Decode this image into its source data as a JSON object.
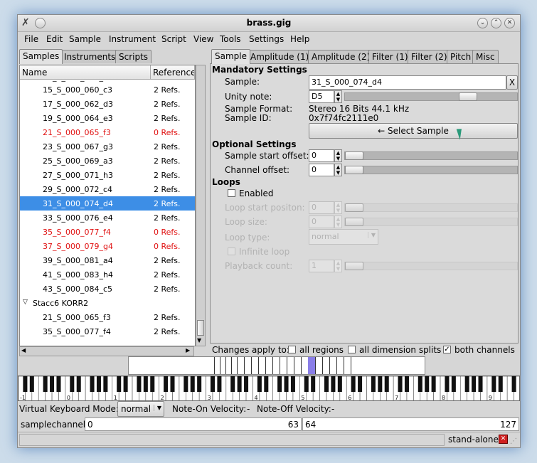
{
  "window": {
    "title": "brass.gig"
  },
  "menu": [
    "File",
    "Edit",
    "Sample",
    "Instrument",
    "Script",
    "View",
    "Tools",
    "Settings",
    "Help"
  ],
  "left_tabs": [
    "Samples",
    "Instruments",
    "Scripts"
  ],
  "list": {
    "columns": [
      "Name",
      "Reference"
    ],
    "rows": [
      {
        "name": "15_S_000_060_c3",
        "refs": "2 Refs.",
        "state": "normal"
      },
      {
        "name": "17_S_000_062_d3",
        "refs": "2 Refs.",
        "state": "normal"
      },
      {
        "name": "19_S_000_064_e3",
        "refs": "2 Refs.",
        "state": "normal"
      },
      {
        "name": "21_S_000_065_f3",
        "refs": "0 Refs.",
        "state": "unused"
      },
      {
        "name": "23_S_000_067_g3",
        "refs": "2 Refs.",
        "state": "normal"
      },
      {
        "name": "25_S_000_069_a3",
        "refs": "2 Refs.",
        "state": "normal"
      },
      {
        "name": "27_S_000_071_h3",
        "refs": "2 Refs.",
        "state": "normal"
      },
      {
        "name": "29_S_000_072_c4",
        "refs": "2 Refs.",
        "state": "normal"
      },
      {
        "name": "31_S_000_074_d4",
        "refs": "2 Refs.",
        "state": "selected"
      },
      {
        "name": "33_S_000_076_e4",
        "refs": "2 Refs.",
        "state": "normal"
      },
      {
        "name": "35_S_000_077_f4",
        "refs": "0 Refs.",
        "state": "unused"
      },
      {
        "name": "37_S_000_079_g4",
        "refs": "0 Refs.",
        "state": "unused"
      },
      {
        "name": "39_S_000_081_a4",
        "refs": "2 Refs.",
        "state": "normal"
      },
      {
        "name": "41_S_000_083_h4",
        "refs": "2 Refs.",
        "state": "normal"
      },
      {
        "name": "43_S_000_084_c5",
        "refs": "2 Refs.",
        "state": "normal"
      },
      {
        "name": "Stacc6 KORR2",
        "refs": "",
        "state": "group"
      },
      {
        "name": "21_S_000_065_f3",
        "refs": "2 Refs.",
        "state": "normal"
      },
      {
        "name": "35_S_000_077_f4",
        "refs": "2 Refs.",
        "state": "normal"
      }
    ]
  },
  "right_tabs": [
    "Sample",
    "Amplitude (1)",
    "Amplitude (2)",
    "Filter (1)",
    "Filter (2)",
    "Pitch",
    "Misc"
  ],
  "mandatory": {
    "heading": "Mandatory Settings",
    "sample_label": "Sample:",
    "sample_value": "31_S_000_074_d4",
    "clear_button": "X",
    "unity_label": "Unity note:",
    "unity_value": "D5",
    "unity_level": 0.74,
    "format_label": "Sample Format:",
    "format_value": "Stereo 16 Bits 44.1 kHz",
    "id_label": "Sample ID:",
    "id_value": "0x7f74fc2111e0",
    "select_button": "← Select Sample"
  },
  "optional": {
    "heading": "Optional Settings",
    "start_label": "Sample start offset:",
    "start_value": "0",
    "channel_label": "Channel offset:",
    "channel_value": "0"
  },
  "loops": {
    "heading": "Loops",
    "enabled_label": "Enabled",
    "loop_start_label": "Loop start positon:",
    "loop_start_value": "0",
    "loop_size_label": "Loop size:",
    "loop_size_value": "0",
    "loop_type_label": "Loop type:",
    "loop_type_value": "normal",
    "infinite_label": "Infinite loop",
    "playback_label": "Playback count:",
    "playback_value": "1"
  },
  "changes": {
    "label": "Changes apply to:",
    "all_regions": "all regions",
    "all_dims": "all dimension splits",
    "both_channels": "both channels",
    "both_checked": true
  },
  "keyboard": {
    "octaves": [
      "-1",
      "0",
      "1",
      "2",
      "3",
      "4",
      "5",
      "6",
      "7",
      "8",
      "9"
    ]
  },
  "vk": {
    "mode_label": "Virtual Keyboard Mode:",
    "mode_value": "normal",
    "on_label": "Note-On Velocity:",
    "on_value": "-",
    "off_label": "Note-Off Velocity:",
    "off_value": "-"
  },
  "channel": {
    "label": "samplechannel",
    "v0": "0",
    "v63": "63",
    "v64": "64",
    "v127": "127"
  },
  "status": {
    "mode": "stand-alone"
  },
  "colors": {
    "selection": "#3d8ee6",
    "unused": "#e01010"
  }
}
